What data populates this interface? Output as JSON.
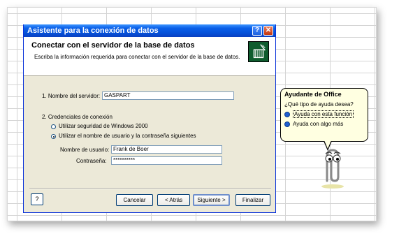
{
  "dialog": {
    "title": "Asistente para la conexión de datos",
    "header_title": "Conectar con el servidor de la base de datos",
    "header_subtitle": "Escriba la información requerida para conectar con el servidor de la base de datos.",
    "server_label": "1. Nombre del servidor:",
    "server_value": "GASPART",
    "credentials_label": "2. Credenciales de conexión",
    "radio_windows": "Utilizar seguridad de Windows 2000",
    "radio_user": "Utilizar el nombre de usuario y la contraseña siguientes",
    "radio_selected": "user",
    "username_label": "Nombre de usuario:",
    "username_value": "Frank de Boer",
    "password_label": "Contraseña:",
    "password_value": "**********",
    "buttons": {
      "help": "?",
      "cancel": "Cancelar",
      "back": "< Atrás",
      "next": "Siguiente >",
      "finish": "Finalizar"
    }
  },
  "assistant": {
    "title": "Ayudante de Office",
    "question": "¿Qué tipo de ayuda desea?",
    "options": [
      "Ayuda con esta función",
      "Ayuda con algo más"
    ]
  },
  "icons": [
    "help-icon",
    "close-icon",
    "database-wizard-icon",
    "help-button-icon",
    "paperclip-assistant-icon"
  ],
  "colors": {
    "titlebar": "#0a5fe8",
    "dialog_bg": "#ece9d8",
    "balloon_bg": "#ffffe1",
    "wizard_icon_bg": "#0f5c2e"
  }
}
